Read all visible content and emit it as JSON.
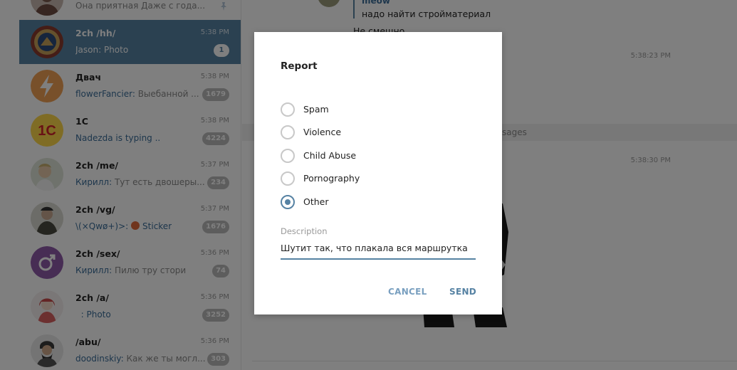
{
  "sidebar": {
    "chats": [
      {
        "title": "",
        "preview": "Она приятная Даже с года...",
        "sender": "",
        "time": "",
        "badge": "",
        "pinned": true
      },
      {
        "title": "2ch /hh/",
        "preview": "Photo",
        "sender": "Jason: ",
        "time": "5:38 PM",
        "badge": "1",
        "active": true
      },
      {
        "title": "Двач",
        "preview": "Выебанной ...",
        "sender": "flowerFancier: ",
        "time": "5:38 PM",
        "badge": "1679"
      },
      {
        "title": "1C",
        "preview": "Nadezda is typing ..",
        "sender": "",
        "time": "5:38 PM",
        "badge": "4224"
      },
      {
        "title": "2ch /me/",
        "preview": "Тут есть двошеры...",
        "sender": "Кирилл: ",
        "time": "5:37 PM",
        "badge": "234"
      },
      {
        "title": "2ch /vg/",
        "preview": "Sticker",
        "sender": "\\(×Qwø+)>: ",
        "time": "5:37 PM",
        "badge": "1676"
      },
      {
        "title": "2ch /sex/",
        "preview": "Пилю тру стори",
        "sender": "Кирилл: ",
        "time": "5:36 PM",
        "badge": "74"
      },
      {
        "title": "2ch /a/",
        "preview": "Photo",
        "sender": "  : ",
        "time": "5:36 PM",
        "badge": "3252"
      },
      {
        "title": "/abu/",
        "preview": "Как же ты могл...",
        "sender": "doodinskiy: ",
        "time": "5:36 PM",
        "badge": "303"
      }
    ]
  },
  "main": {
    "reply_sender": "meow",
    "reply_text": "надо найти стройматериал",
    "message_text": "Не смешно",
    "time_1": "5:38:23 PM",
    "new_messages": "sages",
    "time_2": "5:38:30 PM"
  },
  "modal": {
    "title": "Report",
    "options": [
      "Spam",
      "Violence",
      "Child Abuse",
      "Pornography",
      "Other"
    ],
    "selected": "Other",
    "description_label": "Description",
    "description_value": "Шутит так, что плакала вся маршрутка",
    "cancel_label": "CANCEL",
    "send_label": "SEND"
  },
  "colors": {
    "accent": "#5682a3",
    "overlay": "rgba(0,0,0,0.5)"
  }
}
